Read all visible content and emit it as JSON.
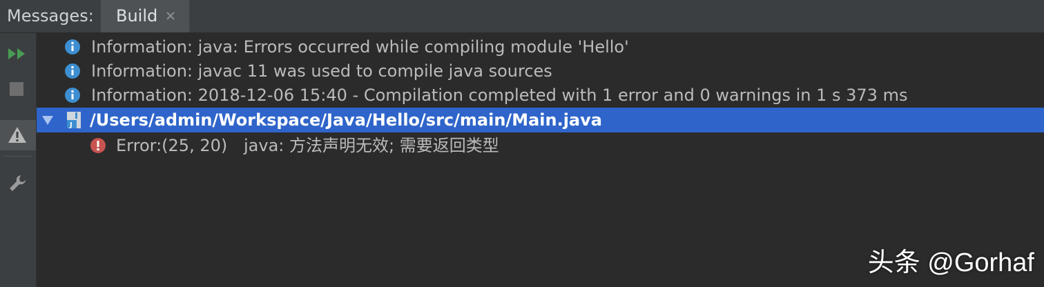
{
  "header": {
    "label": "Messages:",
    "tab_label": "Build"
  },
  "toolbar": {
    "buttons": [
      "rerun-icon",
      "stop-icon",
      "warning-filter-icon",
      "settings-wrench-icon"
    ]
  },
  "messages": [
    {
      "type": "info",
      "text": "Information: java: Errors occurred while compiling module 'Hello'"
    },
    {
      "type": "info",
      "text": "Information: javac 11 was used to compile java sources"
    },
    {
      "type": "info",
      "text": "Information: 2018-12-06 15:40 - Compilation completed with 1 error and 0 warnings in 1 s 373 ms"
    }
  ],
  "file": {
    "path": "/Users/admin/Workspace/Java/Hello/src/main/Main.java",
    "expanded": true
  },
  "error": {
    "location": "Error:(25, 20)",
    "text": "java: 方法声明无效; 需要返回类型"
  },
  "watermark": "头条 @Gorhaf",
  "colors": {
    "selection": "#2f65ca",
    "info": "#3d8fd1",
    "error": "#c75450",
    "run": "#499c54"
  }
}
